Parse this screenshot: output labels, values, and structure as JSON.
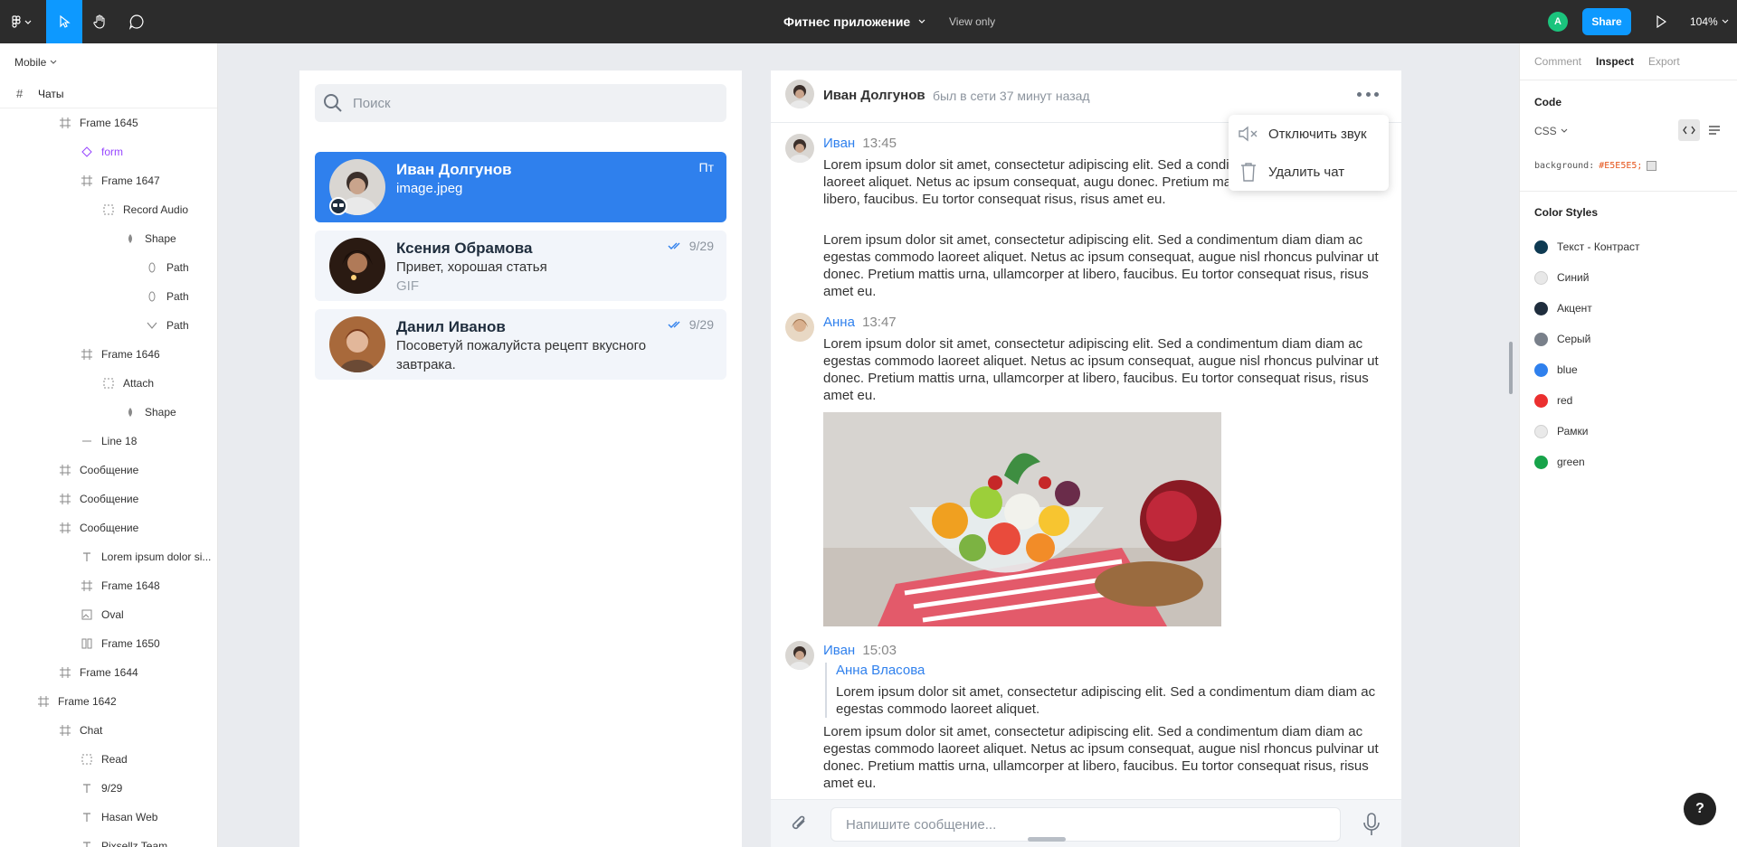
{
  "topbar": {
    "title": "Фитнес приложение",
    "view_only": "View only",
    "avatar_initial": "A",
    "share_label": "Share",
    "zoom": "104%"
  },
  "left": {
    "page": "Mobile",
    "root": "Чаты",
    "layers": [
      {
        "label": "Frame 1645",
        "icon": "frame-icon",
        "indent": 1
      },
      {
        "label": "form",
        "icon": "component-icon",
        "indent": 2,
        "purple": true
      },
      {
        "label": "Frame 1647",
        "icon": "frame-icon",
        "indent": 2
      },
      {
        "label": "Record Audio",
        "icon": "group-icon",
        "indent": 3
      },
      {
        "label": "Shape",
        "icon": "vector-icon",
        "indent": 4
      },
      {
        "label": "Path",
        "icon": "ellipse-path-icon",
        "indent": 5
      },
      {
        "label": "Path",
        "icon": "ellipse-path-icon",
        "indent": 5
      },
      {
        "label": "Path",
        "icon": "check-path-icon",
        "indent": 5
      },
      {
        "label": "Frame 1646",
        "icon": "frame-icon",
        "indent": 2
      },
      {
        "label": "Attach",
        "icon": "group-icon",
        "indent": 3
      },
      {
        "label": "Shape",
        "icon": "vector-icon",
        "indent": 4
      },
      {
        "label": "Line 18",
        "icon": "line-icon",
        "indent": 2
      },
      {
        "label": "Сообщение",
        "icon": "frame-icon",
        "indent": 1
      },
      {
        "label": "Сообщение",
        "icon": "frame-icon",
        "indent": 1
      },
      {
        "label": "Сообщение",
        "icon": "frame-icon",
        "indent": 1
      },
      {
        "label": "Lorem ipsum dolor si...",
        "icon": "text-icon",
        "indent": 2
      },
      {
        "label": "Frame 1648",
        "icon": "frame-icon",
        "indent": 2
      },
      {
        "label": "Oval",
        "icon": "image-icon",
        "indent": 2
      },
      {
        "label": "Frame 1650",
        "icon": "columns-icon",
        "indent": 2
      },
      {
        "label": "Frame 1644",
        "icon": "frame-icon",
        "indent": 1
      },
      {
        "label": "Frame 1642",
        "icon": "frame-icon",
        "indent": 0
      },
      {
        "label": "Chat",
        "icon": "frame-icon",
        "indent": 1
      },
      {
        "label": "Read",
        "icon": "group-icon",
        "indent": 2
      },
      {
        "label": "9/29",
        "icon": "text-icon",
        "indent": 2
      },
      {
        "label": "Hasan Web",
        "icon": "text-icon",
        "indent": 2
      },
      {
        "label": "Pixsellz Team",
        "icon": "text-icon",
        "indent": 2
      }
    ]
  },
  "chatlist": {
    "search_placeholder": "Поиск",
    "items": [
      {
        "name": "Иван Долгунов",
        "line1": "image.jpeg",
        "line2": "",
        "date": "Пт",
        "read": false,
        "active": true
      },
      {
        "name": "Ксения Обрамова",
        "line1": "Привет, хорошая статья",
        "line2": "GIF",
        "date": "9/29",
        "read": true,
        "active": false
      },
      {
        "name": "Данил Иванов",
        "line1": "Посоветуй пожалуйста рецепт вкусного",
        "line2": "завтрака.",
        "date": "9/29",
        "read": true,
        "active": false,
        "line2_dark": true
      }
    ]
  },
  "chat": {
    "name": "Иван Долгунов",
    "status": "был в сети 37 минут назад",
    "messages": [
      {
        "author": "Иван",
        "time": "13:45"
      },
      {
        "author": "Анна",
        "time": "13:47"
      },
      {
        "author": "Иван",
        "time": "15:03"
      }
    ],
    "paragraph_long": "Lorem ipsum dolor sit amet, consectetur adipiscing elit. Sed a condimentum diam diam ac egestas commodo laoreet aliquet. Netus ac ipsum consequat, augue nisl rhoncus pulvinar ut donec. Pretium mattis urna, ullamcorper at libero, faucibus. Eu tortor consequat risus, risus amet eu.",
    "paragraph_clipped": "Lorem ipsum dolor sit amet, consectetur adipiscing elit. Sed a condi egestas commodo laoreet aliquet. Netus ac ipsum consequat, augu donec. Pretium mattis urna, ullamcorper at libero, faucibus. Eu tortor consequat risus, risus amet eu.",
    "quote_author": "Анна Власова",
    "quote_text": "Lorem ipsum dolor sit amet, consectetur adipiscing elit. Sed a condimentum diam diam ac egestas commodo laoreet aliquet.",
    "composer_placeholder": "Напишите сообщение...",
    "menu": {
      "mute": "Отключить звук",
      "delete": "Удалить чат"
    }
  },
  "inspect": {
    "tabs": [
      "Comment",
      "Inspect",
      "Export"
    ],
    "active_tab": "Inspect",
    "code_title": "Code",
    "language": "CSS",
    "code_prop": "background:",
    "code_value": "#E5E5E5;",
    "color_styles_title": "Color Styles",
    "colors": [
      {
        "name": "Текст - Контраст",
        "hex": "#0e3a52"
      },
      {
        "name": "Синий",
        "hex": "#e8e8e8"
      },
      {
        "name": "Акцент",
        "hex": "#1f2d3d"
      },
      {
        "name": "Серый",
        "hex": "#79808a"
      },
      {
        "name": "blue",
        "hex": "#2f80ed"
      },
      {
        "name": "red",
        "hex": "#eb2f2f"
      },
      {
        "name": "Рамки",
        "hex": "#e9e9e9"
      },
      {
        "name": "green",
        "hex": "#17a34a"
      }
    ]
  },
  "help_label": "?"
}
